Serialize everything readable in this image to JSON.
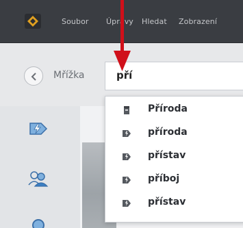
{
  "menubar": {
    "items": [
      "Soubor",
      "Úpravy",
      "Hledat",
      "Zobrazení"
    ]
  },
  "breadcrumb": {
    "label": "Mřížka"
  },
  "search": {
    "value": "pří"
  },
  "suggestions": [
    {
      "label": "Příroda",
      "icon": "collection-icon"
    },
    {
      "label": "příroda",
      "icon": "tag-icon"
    },
    {
      "label": "přístav",
      "icon": "tag-icon"
    },
    {
      "label": "příboj",
      "icon": "tag-icon"
    },
    {
      "label": "přístav",
      "icon": "tag-icon"
    }
  ],
  "colors": {
    "menubar": "#3a3d42",
    "accent": "#3b7fc4",
    "annotation_arrow": "#d0101a"
  }
}
